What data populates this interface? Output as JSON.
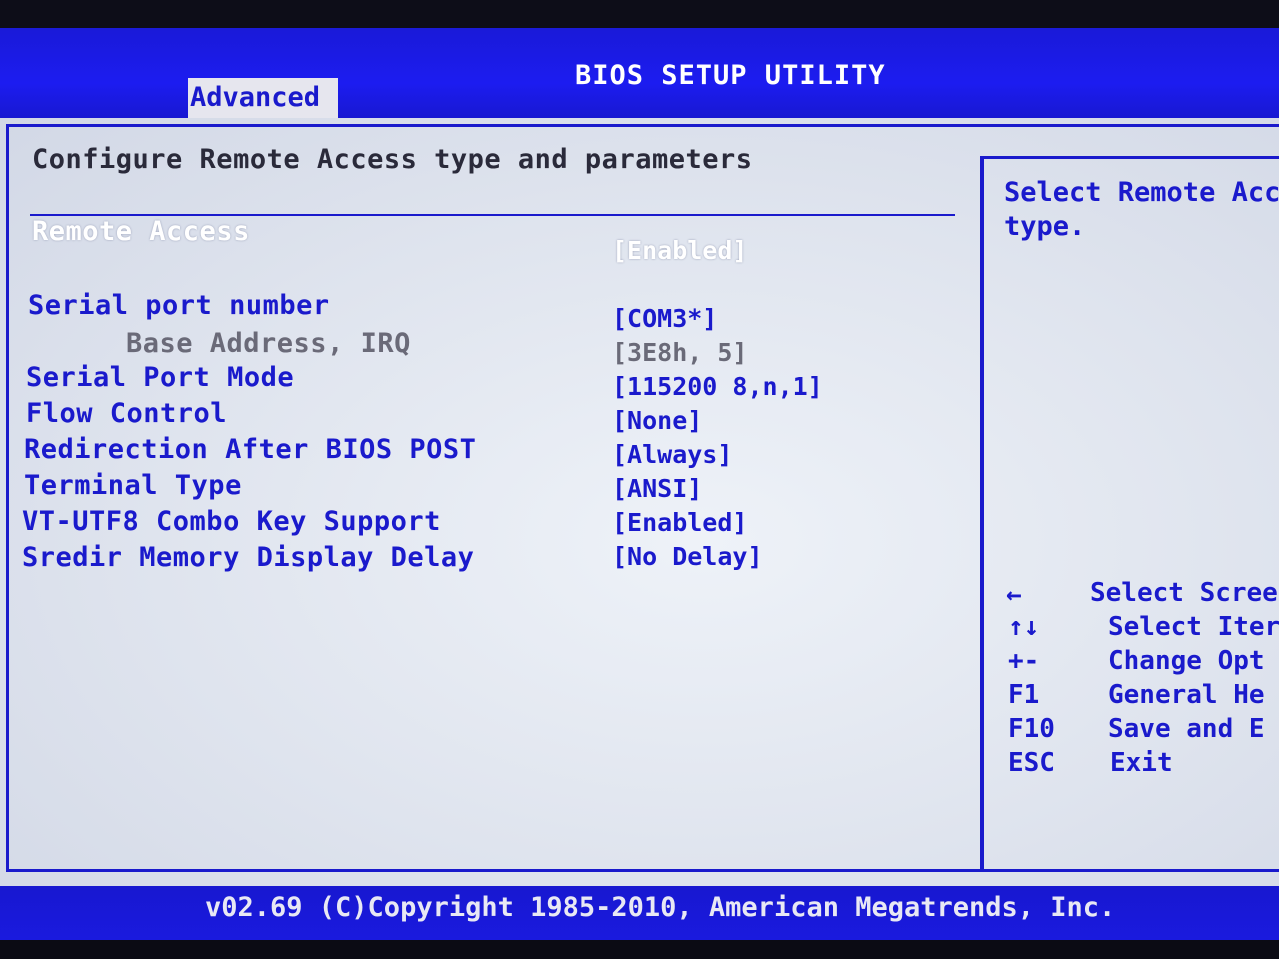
{
  "header": {
    "title": "BIOS SETUP UTILITY",
    "active_tab": "Advanced"
  },
  "section": {
    "title": "Configure Remote Access type and parameters"
  },
  "settings": [
    {
      "label": "Remote Access",
      "value": "[Enabled]",
      "state": "selected"
    },
    {
      "label": "Serial port number",
      "value": "[COM3*]",
      "state": "normal"
    },
    {
      "label": "Base Address, IRQ",
      "value": "[3E8h, 5]",
      "state": "disabled"
    },
    {
      "label": "Serial Port Mode",
      "value": "[115200 8,n,1]",
      "state": "normal"
    },
    {
      "label": "Flow Control",
      "value": "[None]",
      "state": "normal"
    },
    {
      "label": "Redirection After BIOS POST",
      "value": "[Always]",
      "state": "normal"
    },
    {
      "label": "Terminal Type",
      "value": "[ANSI]",
      "state": "normal"
    },
    {
      "label": "VT-UTF8 Combo Key Support",
      "value": "[Enabled]",
      "state": "normal"
    },
    {
      "label": "Sredir Memory Display Delay",
      "value": "[No Delay]",
      "state": "normal"
    }
  ],
  "help": {
    "text": "Select Remote Acc\ntype."
  },
  "keys": [
    {
      "key": "←",
      "desc": "Select Scree"
    },
    {
      "key": "↑↓",
      "desc": "Select Iter"
    },
    {
      "key": "+-",
      "desc": "Change Opt"
    },
    {
      "key": "F1",
      "desc": "General He"
    },
    {
      "key": "F10",
      "desc": "Save and E"
    },
    {
      "key": "ESC",
      "desc": "Exit"
    }
  ],
  "footer": {
    "copyright": "v02.69 (C)Copyright 1985-2010, American Megatrends, Inc."
  },
  "colors": {
    "bios_blue": "#1a1acc",
    "panel_grey": "#dfe4ee",
    "selected_text": "#ffffff",
    "disabled_text": "#6a6a78"
  }
}
